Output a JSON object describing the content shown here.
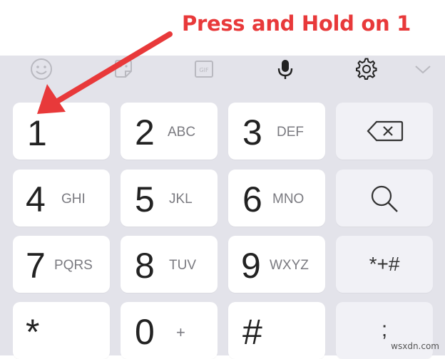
{
  "annotation": {
    "text": "Press and Hold on 1",
    "color": "#e8393a"
  },
  "toolbar": {
    "icons": [
      "emoji-icon",
      "sticker-icon",
      "gif-icon",
      "microphone-icon",
      "gear-icon",
      "chevron-down-icon"
    ]
  },
  "keys": [
    {
      "digit": "1",
      "letters": ""
    },
    {
      "digit": "2",
      "letters": "ABC"
    },
    {
      "digit": "3",
      "letters": "DEF"
    },
    {
      "digit": "4",
      "letters": "GHI"
    },
    {
      "digit": "5",
      "letters": "JKL"
    },
    {
      "digit": "6",
      "letters": "MNO"
    },
    {
      "digit": "7",
      "letters": "PQRS"
    },
    {
      "digit": "8",
      "letters": "TUV"
    },
    {
      "digit": "9",
      "letters": "WXYZ"
    },
    {
      "digit": "*",
      "letters": ""
    },
    {
      "digit": "0",
      "letters": "+"
    },
    {
      "digit": "#",
      "letters": ""
    }
  ],
  "function_keys": {
    "backspace_icon": "backspace-icon",
    "search_icon": "search-icon",
    "symbols_label": "*+#",
    "semicolon_label": ";"
  },
  "watermark": "wsxdn.com",
  "colors": {
    "keyboard_bg": "#e3e3ea",
    "key_bg": "#ffffff",
    "arrow": "#e8393a"
  }
}
